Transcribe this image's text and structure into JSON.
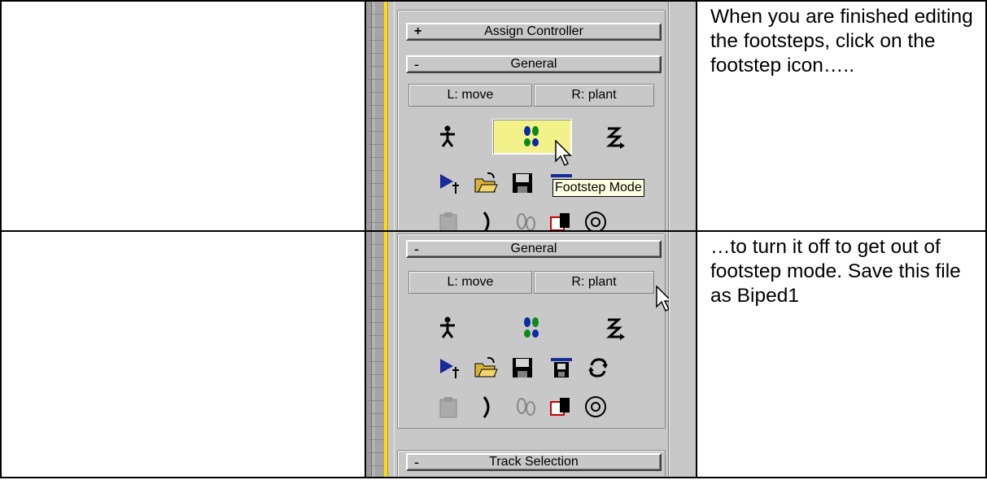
{
  "rows": [
    {
      "caption": "When you are finished editing the footsteps, click on the footstep icon…..",
      "panel": {
        "assign_controller": {
          "sign": "+",
          "label": "Assign Controller"
        },
        "general": {
          "sign": "-",
          "label": "General"
        },
        "mode_left": "L: move",
        "mode_right": "R: plant",
        "tooltip": "Footstep Mode",
        "footstep_button_highlighted": true
      }
    },
    {
      "caption": "…to turn it off to get out of footstep mode. Save this file as Biped1",
      "panel": {
        "general": {
          "sign": "-",
          "label": "General"
        },
        "mode_left": "L: move",
        "mode_right": "R: plant",
        "track_selection": {
          "sign": "-",
          "label": "Track Selection"
        },
        "footstep_button_highlighted": false
      }
    }
  ],
  "icons": [
    "figure-mode-icon",
    "footstep-mode-icon",
    "motion-flow-icon",
    "play-biped-icon",
    "load-file-icon",
    "save-file-icon",
    "convert-icon",
    "refresh-icon",
    "paste-icon",
    "bracket-icon",
    "feet-icon",
    "copy-posture-icon",
    "target-icon"
  ],
  "colors": {
    "highlight": "#f3f18a",
    "tooltip_bg": "#ffffe1",
    "viewport_edge": "#ffd81a",
    "panel_bg": "#c8c8c8"
  }
}
